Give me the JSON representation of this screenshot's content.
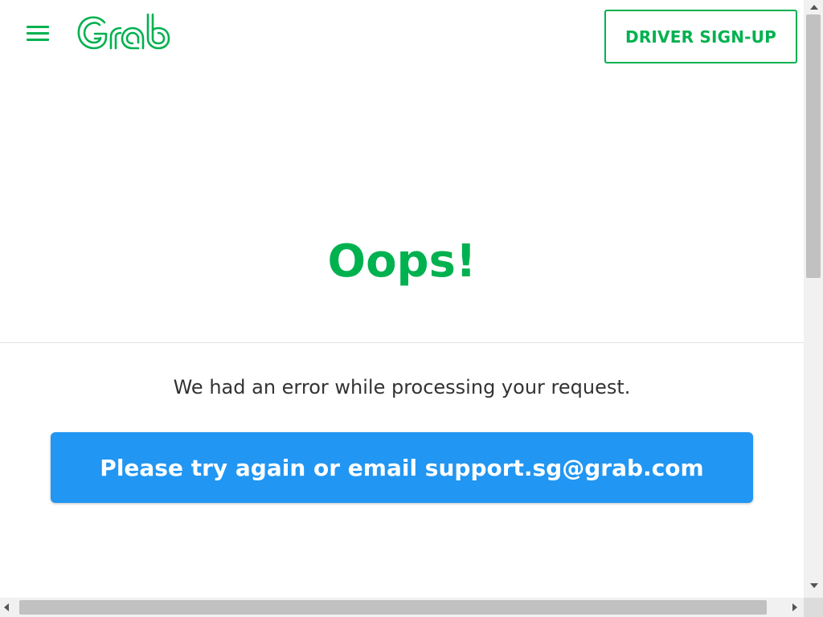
{
  "header": {
    "menu_icon": "hamburger-menu-icon",
    "logo_text": "Grab",
    "signup_label": "DRIVER SIGN-UP"
  },
  "error": {
    "title": "Oops!",
    "message": "We had an error while processing your request.",
    "cta_label": "Please try again or email support.sg@grab.com"
  },
  "colors": {
    "brand_green": "#00b14f",
    "cta_blue": "#2196f3",
    "text": "#333333"
  }
}
